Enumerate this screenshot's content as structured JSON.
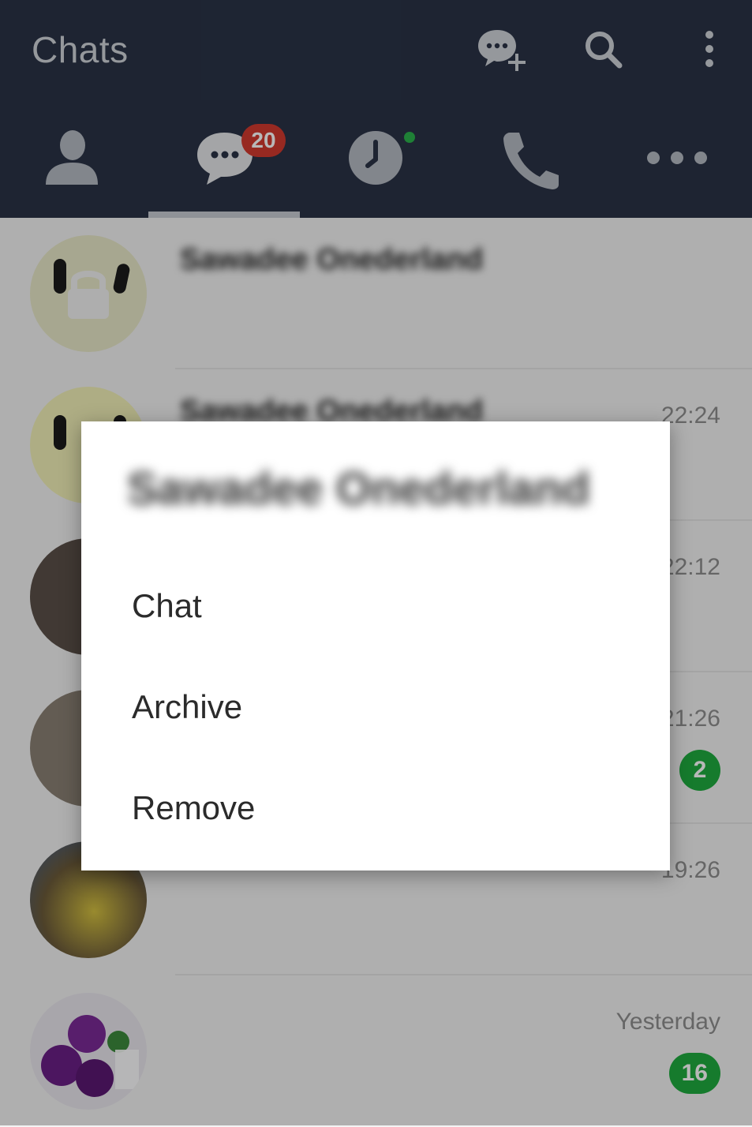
{
  "header": {
    "title": "Chats",
    "actions": [
      "new-chat-icon",
      "search-icon",
      "more-vert-icon"
    ]
  },
  "tabs": [
    {
      "name": "friends",
      "icon": "person-icon"
    },
    {
      "name": "chats",
      "icon": "chat-bubble-icon",
      "badge": "20",
      "active": true
    },
    {
      "name": "timeline",
      "icon": "clock-icon",
      "dot": true
    },
    {
      "name": "calls",
      "icon": "phone-icon"
    },
    {
      "name": "more",
      "icon": "more-horiz-icon"
    }
  ],
  "chats": [
    {
      "name": "Sawadee Onederland",
      "preview": "",
      "time": "",
      "unread": ""
    },
    {
      "name": "Sawadee Onederland",
      "preview": "",
      "time": "22:24",
      "unread": ""
    },
    {
      "name": "",
      "preview": "",
      "time": "22:12",
      "unread": ""
    },
    {
      "name": "",
      "preview": "",
      "time": "21:26",
      "unread": "2"
    },
    {
      "name": "",
      "preview": "",
      "time": "19:26",
      "unread": ""
    },
    {
      "name": "",
      "preview": "",
      "time": "Yesterday",
      "unread": "16"
    }
  ],
  "dialog": {
    "title": "Sawadee Onederland",
    "options": [
      "Chat",
      "Archive",
      "Remove"
    ]
  },
  "colors": {
    "header_bg": "#2a3346",
    "badge_red": "#d23a2f",
    "unread_green": "#1fab3f"
  }
}
